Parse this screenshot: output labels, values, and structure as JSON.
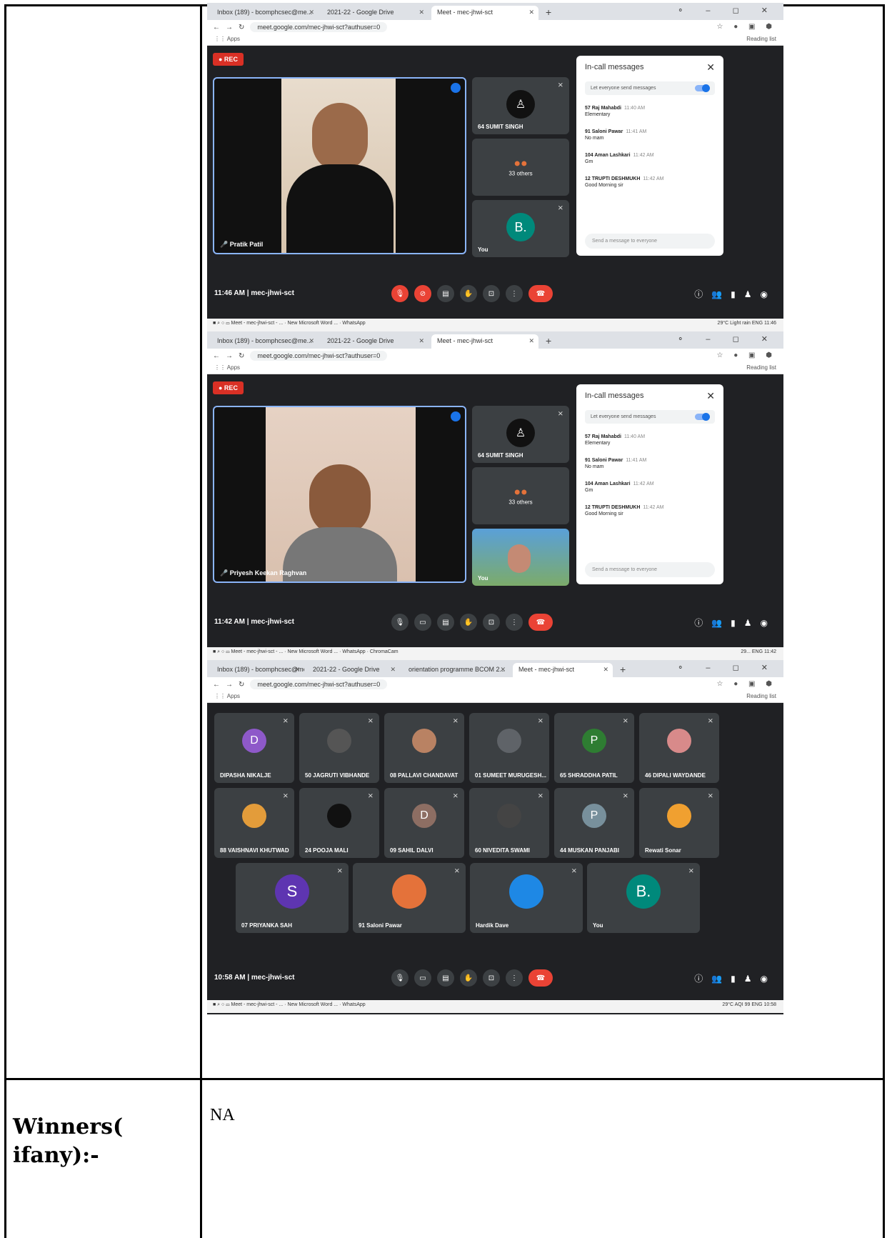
{
  "browser": {
    "tab1": "Inbox (189) - bcomphcsec@me...",
    "tab2": "2021-22 - Google Drive",
    "tab3": "Meet - mec-jhwi-sct",
    "tab3b": "orientation programme BCOM 2...",
    "url": "meet.google.com/mec-jhwi-sct?authuser=0",
    "apps": "Apps",
    "reading_list": "Reading list",
    "controls": "⚬ – ◻ ✕"
  },
  "shot1": {
    "rec": "● REC",
    "speaker": "Pratik Patil",
    "tile1_name": "64 SUMIT SINGH",
    "tile2_label": "33 others",
    "tile3_name": "You",
    "you_initial": "B.",
    "clock": "11:46 AM",
    "meeting": "mec-jhwi-sct",
    "taskbar_right": "29°C Light rain  ENG  11:46"
  },
  "shot2": {
    "rec": "● REC",
    "speaker": "Priyesh Keekan Raghvan",
    "tile1_name": "64 SUMIT SINGH",
    "tile2_label": "33 others",
    "tile3_name": "You",
    "clock": "11:42 AM",
    "meeting": "mec-jhwi-sct",
    "taskbar_right": "29...  ENG  11:42"
  },
  "chat": {
    "title": "In-call messages",
    "toggle_label": "Let everyone send messages",
    "messages": [
      {
        "who": "57 Raj Mahabdi",
        "time": "11:40 AM",
        "text": "Elementary"
      },
      {
        "who": "91 Saloni Pawar",
        "time": "11:41 AM",
        "text": "No mam"
      },
      {
        "who": "104 Aman Lashkari",
        "time": "11:42 AM",
        "text": "Gm"
      },
      {
        "who": "12 TRUPTI DESHMUKH",
        "time": "11:42 AM",
        "text": "Good Morning sir"
      }
    ],
    "send_placeholder": "Send a message to everyone"
  },
  "taskbar_apps": {
    "meet": "Meet - mec-jhwi-sct - ...",
    "word": "New Microsoft Word ...",
    "whatsapp": "WhatsApp",
    "chromacam": "ChromaCam"
  },
  "shot3": {
    "participants": [
      {
        "name": "DIPASHA NIKALJE",
        "initial": "D",
        "color": "#8e59c9"
      },
      {
        "name": "50 JAGRUTI VIBHANDE",
        "initial": "",
        "color": "#555"
      },
      {
        "name": "08 PALLAVI CHANDAVAT",
        "initial": "",
        "color": "#b98263"
      },
      {
        "name": "01 SUMEET MURUGESH...",
        "initial": "",
        "color": "#5f6368"
      },
      {
        "name": "65 SHRADDHA PATIL",
        "initial": "P",
        "color": "#2e7d32"
      },
      {
        "name": "46 DIPALI WAYDANDE",
        "initial": "",
        "color": "#d88a8a"
      },
      {
        "name": "88 VAISHNAVI KHUTWAD",
        "initial": "",
        "color": "#e39c3a"
      },
      {
        "name": "24 POOJA MALI",
        "initial": "",
        "color": "#111"
      },
      {
        "name": "09 SAHIL DALVI",
        "initial": "D",
        "color": "#8d6e63"
      },
      {
        "name": "60 NIVEDITA SWAMI",
        "initial": "",
        "color": "#444"
      },
      {
        "name": "44 MUSKAN PANJABI",
        "initial": "P",
        "color": "#78909c"
      },
      {
        "name": "Rewati Sonar",
        "initial": "",
        "color": "#f0a030"
      },
      {
        "name": "07 PRIYANKA SAH",
        "initial": "S",
        "color": "#5e35b1"
      },
      {
        "name": "91 Saloni Pawar",
        "initial": "",
        "color": "#e4723a"
      },
      {
        "name": "Hardik Dave",
        "initial": "",
        "color": "#1e88e5"
      },
      {
        "name": "You",
        "initial": "B.",
        "color": "#00897b"
      }
    ],
    "clock": "10:58 AM",
    "meeting": "mec-jhwi-sct",
    "taskbar_right": "29°C AQI 99  ENG  10:58"
  },
  "table": {
    "label": "Winners( ifany):-",
    "value": "NA"
  }
}
